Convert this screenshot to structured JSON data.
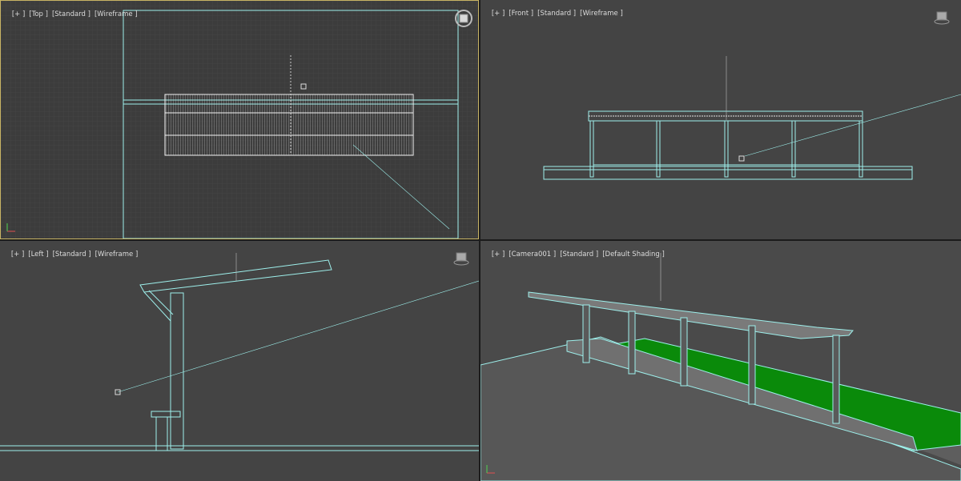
{
  "viewports": {
    "top": {
      "plus": "[+ ]",
      "view": "[Top ]",
      "mode": "[Standard ]",
      "shade": "[Wireframe ]"
    },
    "front": {
      "plus": "[+ ]",
      "view": "[Front ]",
      "mode": "[Standard ]",
      "shade": "[Wireframe ]"
    },
    "left": {
      "plus": "[+ ]",
      "view": "[Left ]",
      "mode": "[Standard ]",
      "shade": "[Wireframe ]"
    },
    "camera": {
      "plus": "[+ ]",
      "view": "[Camera001 ]",
      "mode": "[Standard ]",
      "shade": "[Default Shading ]"
    }
  },
  "icons": [
    "viewcube-icon",
    "view-box-icon",
    "axis-tripod-icon",
    "camera-object-icon"
  ],
  "colors": {
    "wire": "#9ef0ec",
    "grid": "#505050",
    "grass": "#0a8a0a",
    "frame_active": "#c8b464"
  }
}
